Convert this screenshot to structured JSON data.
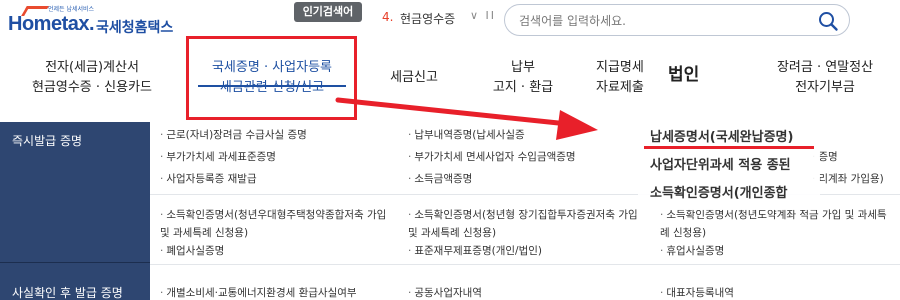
{
  "logo": {
    "tagline": "언제든 납세서비스",
    "mark": "Hometax.",
    "name": "국세청홈택스"
  },
  "hot_search": {
    "badge": "인기검색어",
    "rank": "4.",
    "term": "현금영수증",
    "controls": "∨ II"
  },
  "search": {
    "placeholder": "검색어를 입력하세요.",
    "icon": "search-icon"
  },
  "nav": [
    {
      "line1": "전자(세금)계산서",
      "line2": "현금영수증 · 신용카드"
    },
    {
      "line1": "국세증명 · 사업자등록",
      "line2": "세금관련 신청/신고"
    },
    {
      "line1": "세금신고",
      "line2": ""
    },
    {
      "line1": "납부",
      "line2": "고지 · 환급"
    },
    {
      "line1": "지급명세",
      "line2": "자료제출"
    },
    {
      "line1": "장려금 · 연말정산",
      "line2": "전자기부금"
    }
  ],
  "overlay": {
    "title": "법인",
    "lines": [
      "납세증명서(국세완납증명)",
      "사업자단위과세 적용 종된",
      "소득확인증명서(개인종합"
    ]
  },
  "sidebar": [
    {
      "title": "즉시발급 증명"
    },
    {
      "title": "사실확인 후 발급 증명"
    }
  ],
  "links": {
    "col1": [
      "근로(자녀)장려금 수급사실 증명",
      "부가가치세 과세표준증명",
      "사업자등록증 재발급",
      "소득확인증명서(청년우대형주택청약종합저축 가입 및 과세특례 신청용)",
      "폐업사실증명",
      "개별소비세·교통에너지환경세 환급사실여부"
    ],
    "col2": [
      "납부내역증명(납세사실증",
      "부가가치세 면세사업자 수입금액증명",
      "소득금액증명",
      "소득확인증명서(청년형 장기집합투자증권저축 가입 및 과세특례 신청용)",
      "표준재무제표증명(개인/법인)",
      "공동사업자내역"
    ],
    "col3": [
      "증명",
      "리계좌 가입용)",
      "소득확인증명서(청년도약계좌 적금 가입 및 과세특례 신청용)",
      "휴업사실증명",
      "대표자등록내역"
    ]
  },
  "colors": {
    "accent_red": "#e8202a",
    "brand_blue": "#1f4fa3",
    "sidebar_bg": "#2e4671"
  }
}
